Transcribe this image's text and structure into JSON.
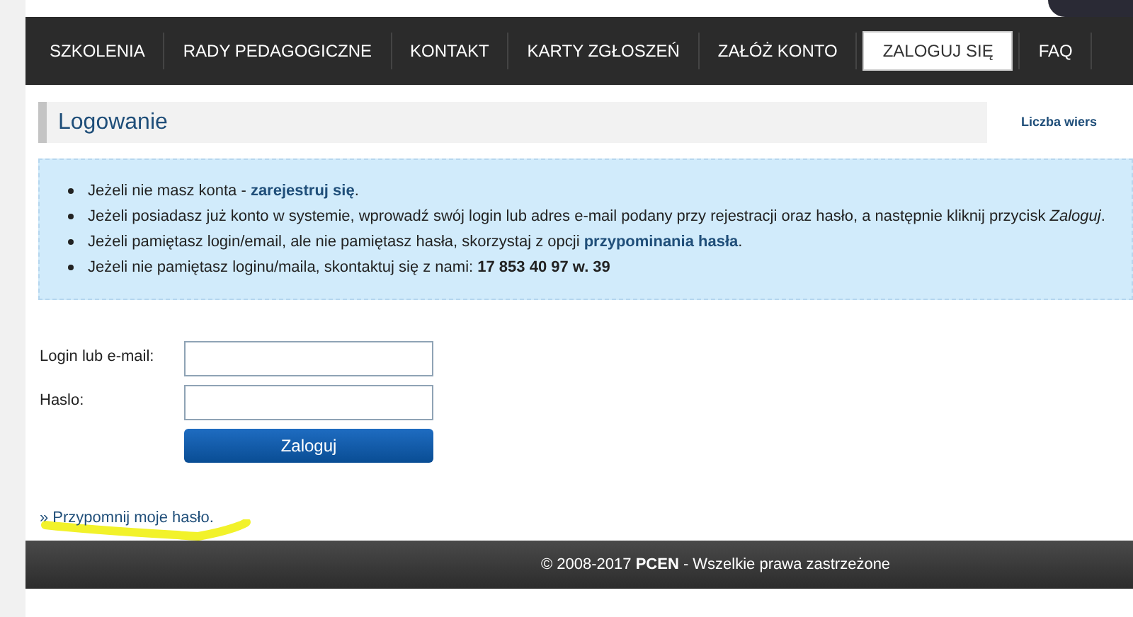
{
  "nav": [
    {
      "label": "SZKOLENIA",
      "selected": false
    },
    {
      "label": "RADY PEDAGOGICZNE",
      "selected": false
    },
    {
      "label": "KONTAKT",
      "selected": false
    },
    {
      "label": "KARTY ZGŁOSZEŃ",
      "selected": false
    },
    {
      "label": "ZAŁÓŻ KONTO",
      "selected": false
    },
    {
      "label": "ZALOGUJ SIĘ",
      "selected": true
    },
    {
      "label": "FAQ",
      "selected": false
    }
  ],
  "heading": "Logowanie",
  "side_link": "Liczba wiers",
  "info": [
    [
      {
        "kind": "text",
        "text": "Jeżeli nie masz konta - "
      },
      {
        "kind": "link",
        "text": "zarejestruj się"
      },
      {
        "kind": "text",
        "text": "."
      }
    ],
    [
      {
        "kind": "text",
        "text": "Jeżeli posiadasz już konto w systemie, wprowadź swój login lub adres e-mail podany przy rejestracji oraz hasło, a następnie kliknij przycisk *Zaloguj*."
      }
    ],
    [
      {
        "kind": "text",
        "text": "Jeżeli pamiętasz login/email, ale nie pamiętasz hasła, skorzystaj z opcji "
      },
      {
        "kind": "link",
        "text": "przypominania hasła"
      },
      {
        "kind": "text",
        "text": "."
      }
    ],
    [
      {
        "kind": "text",
        "text": "Jeżeli nie pamiętasz loginu/maila, skontaktuj się z nami: **17 853 40 97 w. 39**"
      }
    ]
  ],
  "form": {
    "fields": [
      {
        "label": "Login lub e-mail:"
      },
      {
        "label": "Haslo:"
      }
    ],
    "submit": "Zaloguj"
  },
  "remind_link": "» Przypomnij moje hasło.",
  "footer": "© 2008-2017 **PCEN** - Wszelkie prawa zastrzeżone"
}
